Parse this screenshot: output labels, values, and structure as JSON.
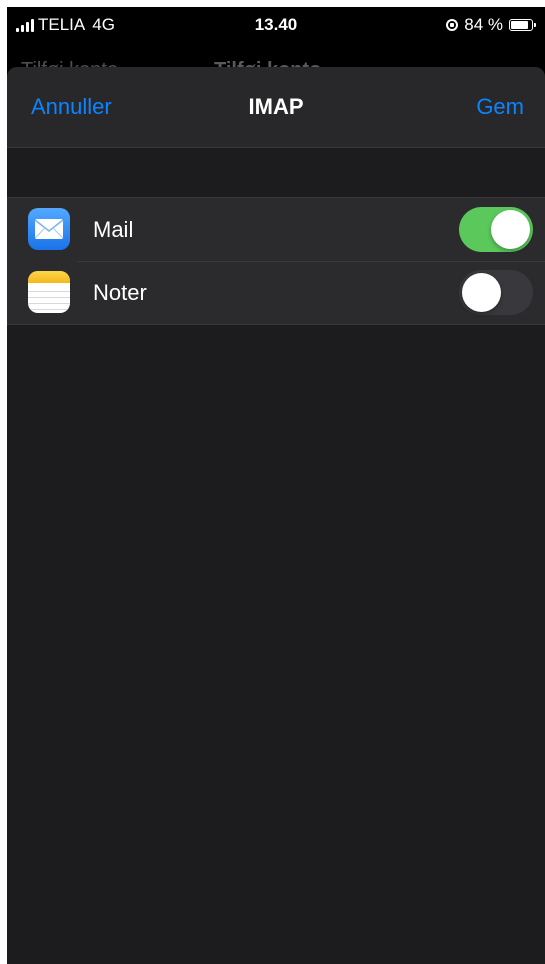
{
  "status_bar": {
    "carrier": "TELIA",
    "network": "4G",
    "time": "13.40",
    "battery": "84 %",
    "battery_level": 0.84
  },
  "background_nav": {
    "back_label": "Tilføj konto",
    "title": "Tilføj konto"
  },
  "nav": {
    "cancel_label": "Annuller",
    "title": "IMAP",
    "save_label": "Gem"
  },
  "colors": {
    "accent": "#0a84ff",
    "toggle_on": "#5ac85a"
  },
  "settings": [
    {
      "label": "Mail",
      "icon": "mail-app-icon",
      "enabled": true
    },
    {
      "label": "Noter",
      "icon": "notes-app-icon",
      "enabled": false
    }
  ]
}
